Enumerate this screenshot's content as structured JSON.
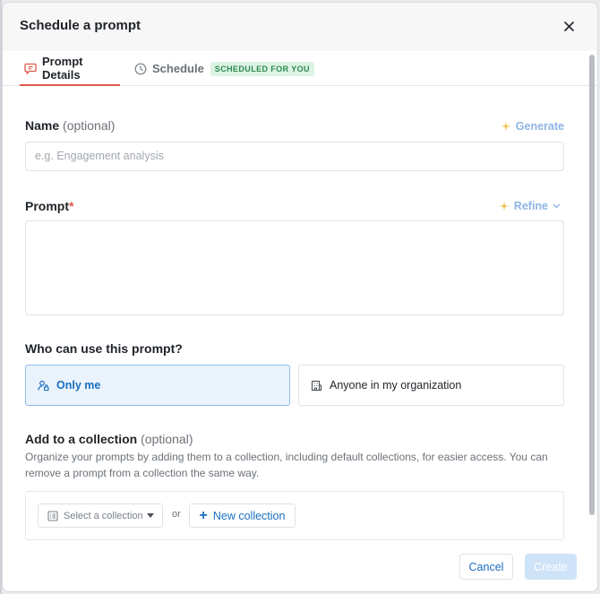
{
  "dialog": {
    "title": "Schedule a prompt",
    "close_icon": "close-icon"
  },
  "tabs": [
    {
      "label": "Prompt Details",
      "icon": "chat-icon",
      "active": true
    },
    {
      "label": "Schedule",
      "icon": "clock-icon",
      "active": false,
      "badge": "SCHEDULED FOR YOU"
    }
  ],
  "name_field": {
    "label": "Name",
    "optional": "(optional)",
    "action": "Generate",
    "placeholder": "e.g. Engagement analysis",
    "value": ""
  },
  "prompt_field": {
    "label": "Prompt",
    "required_mark": "*",
    "action": "Refine",
    "value": ""
  },
  "visibility": {
    "title": "Who can use this prompt?",
    "options": [
      {
        "label": "Only me",
        "icon": "user-lock-icon",
        "selected": true
      },
      {
        "label": "Anyone in my organization",
        "icon": "building-icon",
        "selected": false
      }
    ]
  },
  "collection": {
    "title": "Add to a collection",
    "optional": "(optional)",
    "help": "Organize your prompts by adding them to a collection, including default collections, for easier access. You can remove a prompt from a collection the same way.",
    "select_placeholder": "Select a collection",
    "or_text": "or",
    "new_button": "New collection"
  },
  "footer": {
    "cancel": "Cancel",
    "create": "Create"
  },
  "colors": {
    "accent": "#1a6fbd",
    "active_tab_underline": "#e0574b",
    "required": "#e0574b",
    "badge_bg": "#dcf3e4",
    "badge_text": "#2f8a52",
    "ai_action": "#8fb4e6",
    "create_disabled": "#cfe3f8"
  }
}
